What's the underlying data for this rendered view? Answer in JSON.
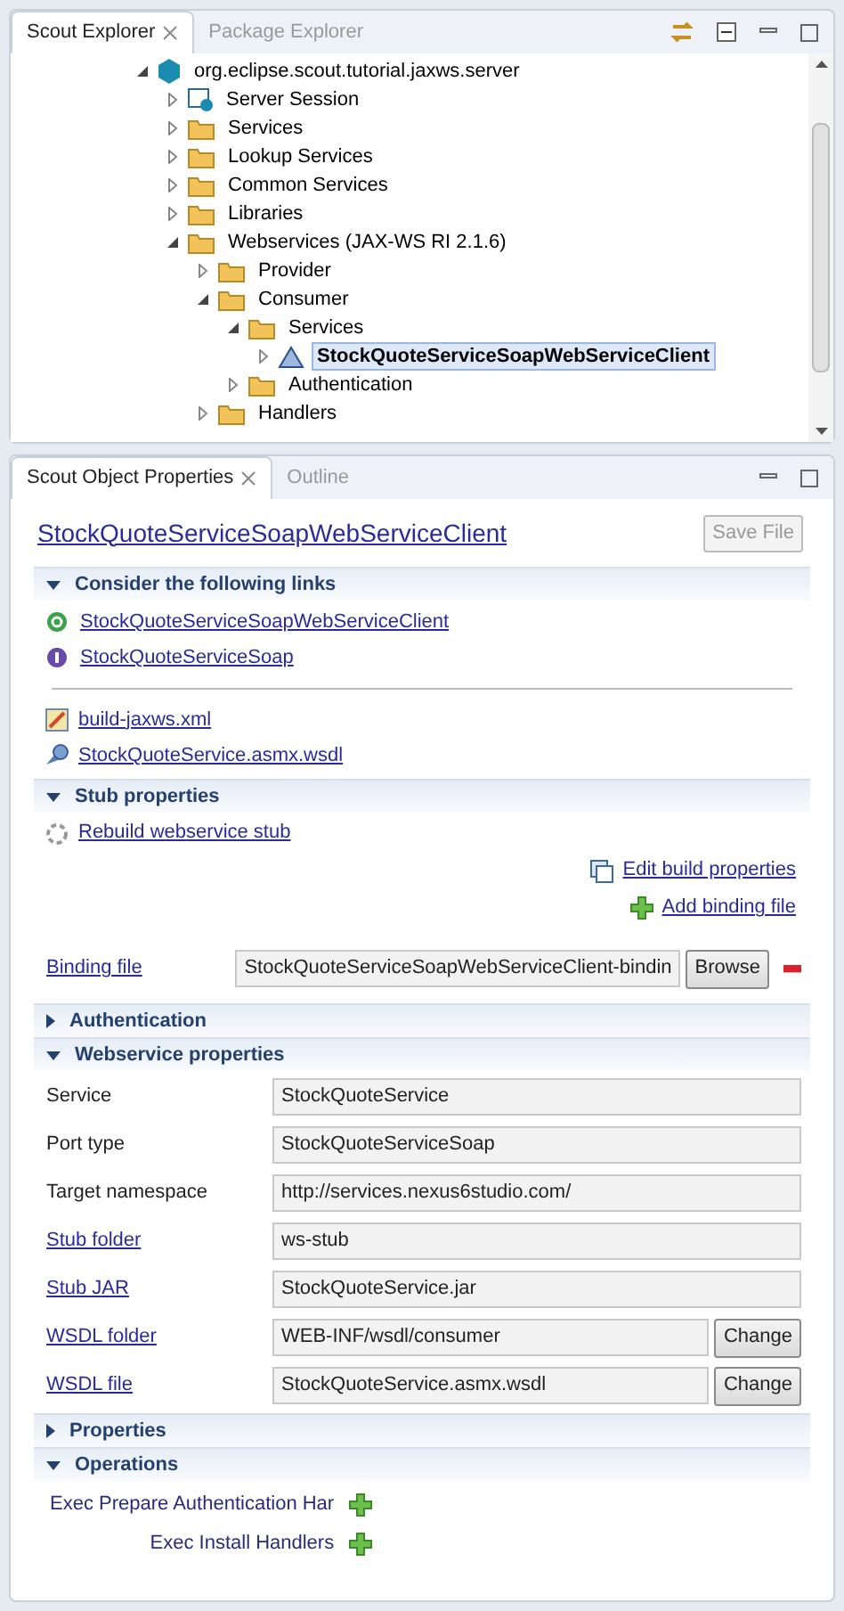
{
  "explorer": {
    "tabs": [
      {
        "label": "Scout Explorer",
        "selected": true,
        "closable": true
      },
      {
        "label": "Package Explorer",
        "selected": false,
        "closable": false
      }
    ],
    "tree": [
      {
        "label": "org.eclipse.scout.tutorial.jaxws.server",
        "kind": "project",
        "expanded": true,
        "selected": false,
        "children": [
          {
            "label": "Server Session",
            "kind": "session",
            "expanded": false,
            "selected": false
          },
          {
            "label": "Services",
            "kind": "folder",
            "expanded": false,
            "selected": false
          },
          {
            "label": "Lookup Services",
            "kind": "folder",
            "expanded": false,
            "selected": false
          },
          {
            "label": "Common Services",
            "kind": "folder",
            "expanded": false,
            "selected": false
          },
          {
            "label": "Libraries",
            "kind": "folder",
            "expanded": false,
            "selected": false
          },
          {
            "label": "Webservices (JAX-WS RI 2.1.6)",
            "kind": "folder",
            "expanded": true,
            "selected": false,
            "children": [
              {
                "label": "Provider",
                "kind": "folder",
                "expanded": false,
                "selected": false
              },
              {
                "label": "Consumer",
                "kind": "folder",
                "expanded": true,
                "selected": false,
                "children": [
                  {
                    "label": "Services",
                    "kind": "folder",
                    "expanded": true,
                    "selected": false,
                    "children": [
                      {
                        "label": "StockQuoteServiceSoapWebServiceClient",
                        "kind": "client",
                        "expanded": false,
                        "selected": true
                      }
                    ]
                  },
                  {
                    "label": "Authentication",
                    "kind": "folder",
                    "expanded": false,
                    "selected": false
                  }
                ]
              },
              {
                "label": "Handlers",
                "kind": "folder",
                "expanded": false,
                "selected": false
              }
            ]
          }
        ]
      }
    ]
  },
  "properties": {
    "tabs": [
      {
        "label": "Scout Object Properties",
        "selected": true,
        "closable": true
      },
      {
        "label": "Outline",
        "selected": false,
        "closable": false
      }
    ],
    "title": "StockQuoteServiceSoapWebServiceClient",
    "save_button": {
      "label": "Save File",
      "disabled": true
    },
    "sections": [
      {
        "kind": "links",
        "title": "Consider the following links",
        "expanded": true,
        "links": [
          {
            "label": "StockQuoteServiceSoapWebServiceClient",
            "kind": "class"
          },
          {
            "label": "StockQuoteServiceSoap",
            "kind": "interface"
          }
        ],
        "files": [
          {
            "label": "build-jaxws.xml",
            "kind": "xml"
          },
          {
            "label": "StockQuoteService.asmx.wsdl",
            "kind": "wsdl"
          }
        ]
      },
      {
        "kind": "stub",
        "title": "Stub properties",
        "expanded": true,
        "rebuild": "Rebuild webservice stub",
        "actions": [
          {
            "label": "Edit build properties",
            "kind": "edit"
          },
          {
            "label": "Add binding file",
            "kind": "add"
          }
        ],
        "fields": [
          {
            "label": "Binding file",
            "link": true,
            "value": "StockQuoteServiceSoapWebServiceClient-bindin",
            "button": "Browse",
            "removable": true
          }
        ]
      },
      {
        "title": "Authentication",
        "expanded": false
      },
      {
        "kind": "fields",
        "title": "Webservice properties",
        "expanded": true,
        "fields": [
          {
            "label": "Service",
            "link": false,
            "value": "StockQuoteService",
            "removable": false
          },
          {
            "label": "Port type",
            "link": false,
            "value": "StockQuoteServiceSoap",
            "removable": false
          },
          {
            "label": "Target namespace",
            "link": false,
            "value": "http://services.nexus6studio.com/",
            "removable": false
          },
          {
            "label": "Stub folder",
            "link": true,
            "value": "ws-stub",
            "removable": false
          },
          {
            "label": "Stub JAR",
            "link": true,
            "value": "StockQuoteService.jar",
            "removable": false
          },
          {
            "label": "WSDL folder",
            "link": true,
            "value": "WEB-INF/wsdl/consumer",
            "button": "Change",
            "removable": false
          },
          {
            "label": "WSDL file",
            "link": true,
            "value": "StockQuoteService.asmx.wsdl",
            "button": "Change",
            "removable": false
          }
        ]
      },
      {
        "title": "Properties",
        "expanded": false
      },
      {
        "kind": "operations",
        "title": "Operations",
        "expanded": true,
        "operations": [
          {
            "label": "Exec Prepare Authentication Har"
          },
          {
            "label": "Exec Install Handlers"
          }
        ]
      }
    ]
  }
}
